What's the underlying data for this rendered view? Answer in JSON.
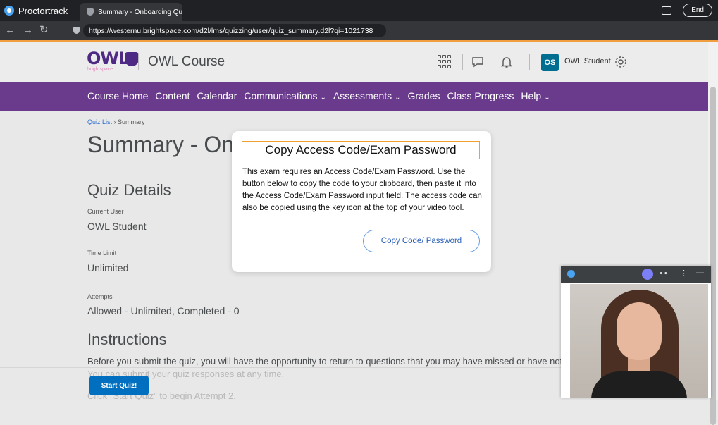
{
  "browser": {
    "app_name": "Proctortrack",
    "tab_title": "Summary - Onboarding Qui...",
    "url": "https://westernu.brightspace.com/d2l/lms/quizzing/user/quiz_summary.d2l?qi=1021738",
    "end_label": "End"
  },
  "header": {
    "logo_text": "OWL",
    "logo_sub": "brightspace",
    "course_name": "OWL Course",
    "avatar_initials": "OS",
    "user_name": "OWL Student"
  },
  "nav": {
    "items": [
      {
        "label": "Course Home",
        "dropdown": ""
      },
      {
        "label": "Content",
        "dropdown": ""
      },
      {
        "label": "Calendar",
        "dropdown": ""
      },
      {
        "label": "Communications",
        "dropdown": "⌄"
      },
      {
        "label": "Assessments",
        "dropdown": "⌄"
      },
      {
        "label": "Grades",
        "dropdown": ""
      },
      {
        "label": "Class Progress",
        "dropdown": ""
      },
      {
        "label": "Help",
        "dropdown": "⌄"
      }
    ]
  },
  "page": {
    "breadcrumb_link": "Quiz List",
    "breadcrumb_sep": "›",
    "breadcrumb_current": "Summary",
    "title": "Summary - Onboa",
    "quiz_details_heading": "Quiz Details",
    "current_user_label": "Current User",
    "current_user_value": "OWL Student",
    "time_limit_label": "Time Limit",
    "time_limit_value": "Unlimited",
    "attempts_label": "Attempts",
    "attempts_value": "Allowed - Unlimited, Completed - 0",
    "instructions_heading": "Instructions",
    "instructions_line1": "Before you submit the quiz, you will have the opportunity to return to questions that you may have missed or have not ye",
    "instructions_line2": "You can submit your quiz responses at any time.",
    "instructions_line3": "Click \"Start Quiz\" to begin Attempt 2.",
    "start_button": "Start Quiz!"
  },
  "modal": {
    "title": "Copy Access Code/Exam Password",
    "body": "This exam requires an Access Code/Exam Password. Use the button below to copy the code to your clipboard, then paste it into the Access Code/Exam Password input field. The access code can also be copied using the key icon at the top of your video tool.",
    "button": "Copy Code/ Password"
  },
  "colors": {
    "nav_purple": "#6a3b8c",
    "brand_purple": "#4e2a84",
    "button_blue": "#006fbf",
    "modal_title_border": "#f0a030",
    "avatar_teal": "#006e91"
  }
}
